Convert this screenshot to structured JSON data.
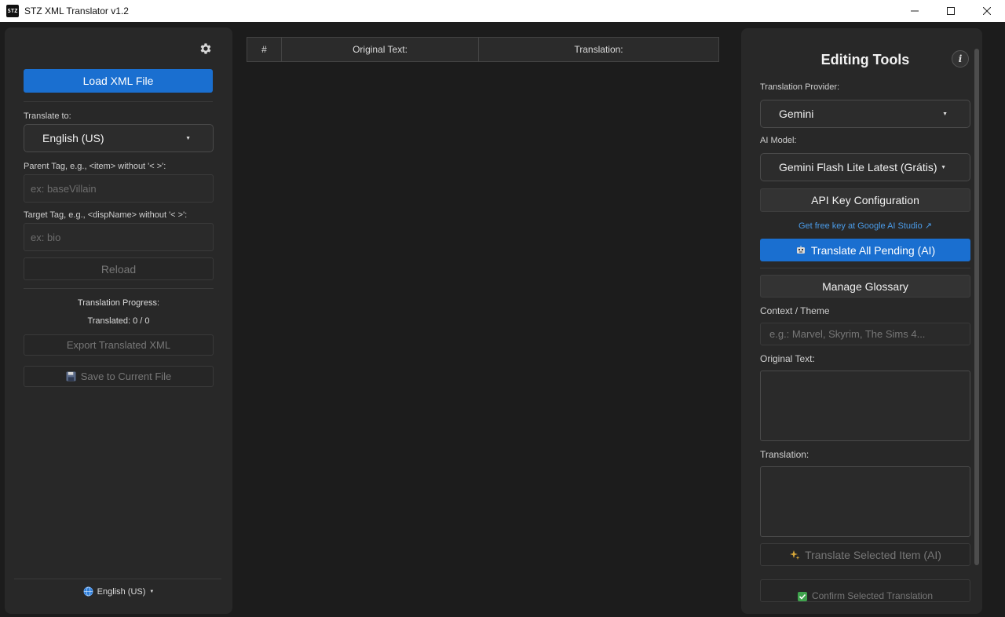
{
  "window": {
    "title": "STZ XML Translator v1.2",
    "app_icon_text": "STZ"
  },
  "left": {
    "load_button": "Load XML File",
    "translate_to_label": "Translate to:",
    "translate_to_value": "English (US)",
    "parent_tag_label": "Parent Tag, e.g., <item> without '< >':",
    "parent_tag_placeholder": "ex: baseVillain",
    "target_tag_label": "Target Tag, e.g., <dispName> without '< >':",
    "target_tag_placeholder": "ex: bio",
    "reload_button": "Reload",
    "progress_title": "Translation Progress:",
    "progress_count": "Translated: 0 / 0",
    "export_button": "Export Translated XML",
    "save_button": "Save to Current File",
    "ui_language": "English (US)"
  },
  "table": {
    "columns": [
      "#",
      "Original Text:",
      "Translation:"
    ]
  },
  "right": {
    "title": "Editing Tools",
    "provider_label": "Translation Provider:",
    "provider_value": "Gemini",
    "model_label": "AI Model:",
    "model_value": "Gemini Flash Lite Latest (Grátis)",
    "api_key_button": "API Key Configuration",
    "free_key_link": "Get free key at Google AI Studio ↗",
    "translate_all_button": "Translate All Pending (AI)",
    "glossary_button": "Manage Glossary",
    "context_label": "Context / Theme",
    "context_placeholder": "e.g.: Marvel, Skyrim, The Sims 4...",
    "original_label": "Original Text:",
    "translation_label": "Translation:",
    "translate_selected_button": "Translate Selected Item (AI)",
    "confirm_button": "Confirm Selected Translation"
  },
  "colors": {
    "accent": "#1a6fd0",
    "panel": "#282828",
    "background": "#1c1c1c",
    "link": "#4a9be8"
  }
}
